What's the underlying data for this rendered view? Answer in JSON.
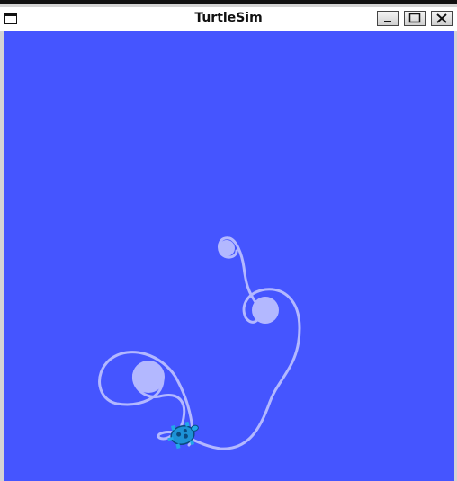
{
  "window": {
    "title": "TurtleSim"
  },
  "controls": {
    "minimize": "minimize-icon",
    "maximize": "maximize-icon",
    "close": "close-icon"
  },
  "canvas": {
    "background_color": "#4555ff",
    "pen_color": "#b3b8ff"
  }
}
